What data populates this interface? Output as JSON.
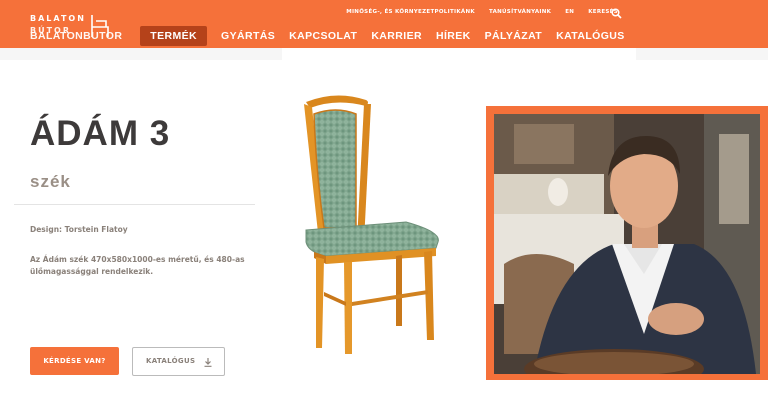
{
  "logo": {
    "line1": "BALATON",
    "line2": "BÚTOR"
  },
  "topnav": [
    "MINŐSÉG-, ÉS KÖRNYEZETPOLITIKÁNK",
    "TANÚSÍTVÁNYAINK",
    "EN",
    "KERESÉS"
  ],
  "mainnav": {
    "brand": "BALATONBUTOR",
    "items": [
      "TERMÉK",
      "GYÁRTÁS",
      "KAPCSOLAT",
      "KARRIER",
      "HÍREK",
      "PÁLYÁZAT",
      "KATALÓGUS"
    ],
    "active": "TERMÉK"
  },
  "product": {
    "name": "ÁDÁM 3",
    "category": "szék",
    "designer": "Design: Torstein Flatoy",
    "description": "Az Ádám szék 470x580x1000-es méretű, és 480-as ülőmagassággal rendelkezik."
  },
  "buttons": {
    "question": "KÉRDÉSE VAN?",
    "catalog": "KATALÓGUS"
  },
  "icons": [
    "search-icon",
    "download-icon",
    "logo-chair-icon"
  ],
  "colors": {
    "accent": "#f5713a",
    "active_tab": "#b5421a",
    "title": "#3d3a3a",
    "muted": "#9a8f86"
  }
}
